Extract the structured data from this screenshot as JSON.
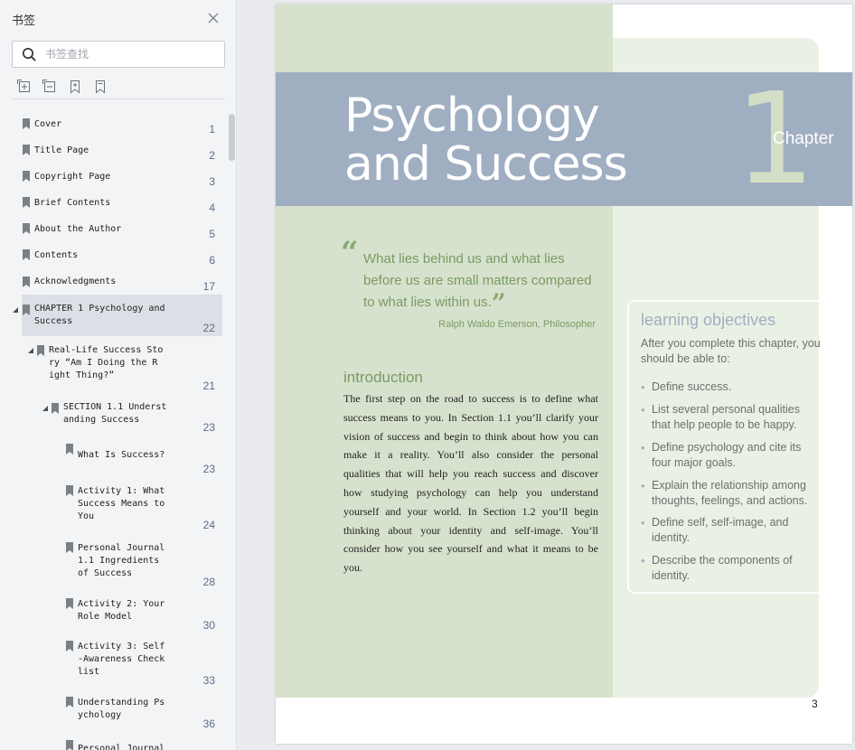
{
  "sidebar": {
    "title": "书签",
    "search_placeholder": "书签查找",
    "bookmarks": [
      {
        "label": "Cover",
        "page": "1"
      },
      {
        "label": "Title Page",
        "page": "2"
      },
      {
        "label": "Copyright Page",
        "page": "3"
      },
      {
        "label": "Brief Contents",
        "page": "4"
      },
      {
        "label": "About the Author",
        "page": "5"
      },
      {
        "label": "Contents",
        "page": "6"
      },
      {
        "label": "Acknowledgments",
        "page": "17"
      },
      {
        "label": "CHAPTER 1 Psychology and\nSuccess",
        "page": "22"
      },
      {
        "label": "Real-Life Success Sto\nry “Am I Doing the R\night Thing?”",
        "page": "21"
      },
      {
        "label": "SECTION 1.1 Underst\nanding Success",
        "page": "23"
      },
      {
        "label": "What Is Success?",
        "page": "23"
      },
      {
        "label": "Activity 1: What\nSuccess Means to\nYou",
        "page": "24"
      },
      {
        "label": "Personal Journal\n1.1 Ingredients\nof Success",
        "page": "28"
      },
      {
        "label": "Activity 2: Your\nRole Model",
        "page": "30"
      },
      {
        "label": "Activity 3: Self\n-Awareness Check\nlist",
        "page": "33"
      },
      {
        "label": "Understanding Ps\nychology",
        "page": "36"
      },
      {
        "label": "Personal Journal",
        "page": ""
      }
    ]
  },
  "page": {
    "chapter_title_line1": "Psychology",
    "chapter_title_line2": "and Success",
    "chapter_number": "1",
    "chapter_word": "Chapter",
    "quote": "What lies behind us and what lies before us are small matters compared to what lies within us.",
    "quote_open": "“",
    "quote_close": "”",
    "quote_author": "Ralph Waldo Emerson, Philosopher",
    "intro_heading": "introduction",
    "intro_body": "The first step on the road to success is to define what success means to you. In Section 1.1 you’ll clarify your vision of success and begin to think about how you can make it a reality. You’ll also consider the personal qualities that will help you reach success and discover how studying psychology can help you understand yourself and your world. In Section 1.2 you’ll begin thinking about your identity and self-image. You’ll consider how you see yourself and what it means to be you.",
    "lo_heading": "learning objectives",
    "lo_intro": "After you complete this chapter, you should be able to:",
    "lo_items": [
      "Define success.",
      "List several personal qualities that help people to be happy.",
      "Define psychology and cite its four major goals.",
      "Explain the relationship among thoughts, feelings, and actions.",
      "Define self, self-image, and identity.",
      "Describe the components of identity."
    ],
    "page_number": "3"
  },
  "colors": {
    "band": "#a0aec2",
    "green_panel": "#d6e2cd",
    "green_text": "#7c9a64",
    "selected_row": "#dcdfe5"
  }
}
